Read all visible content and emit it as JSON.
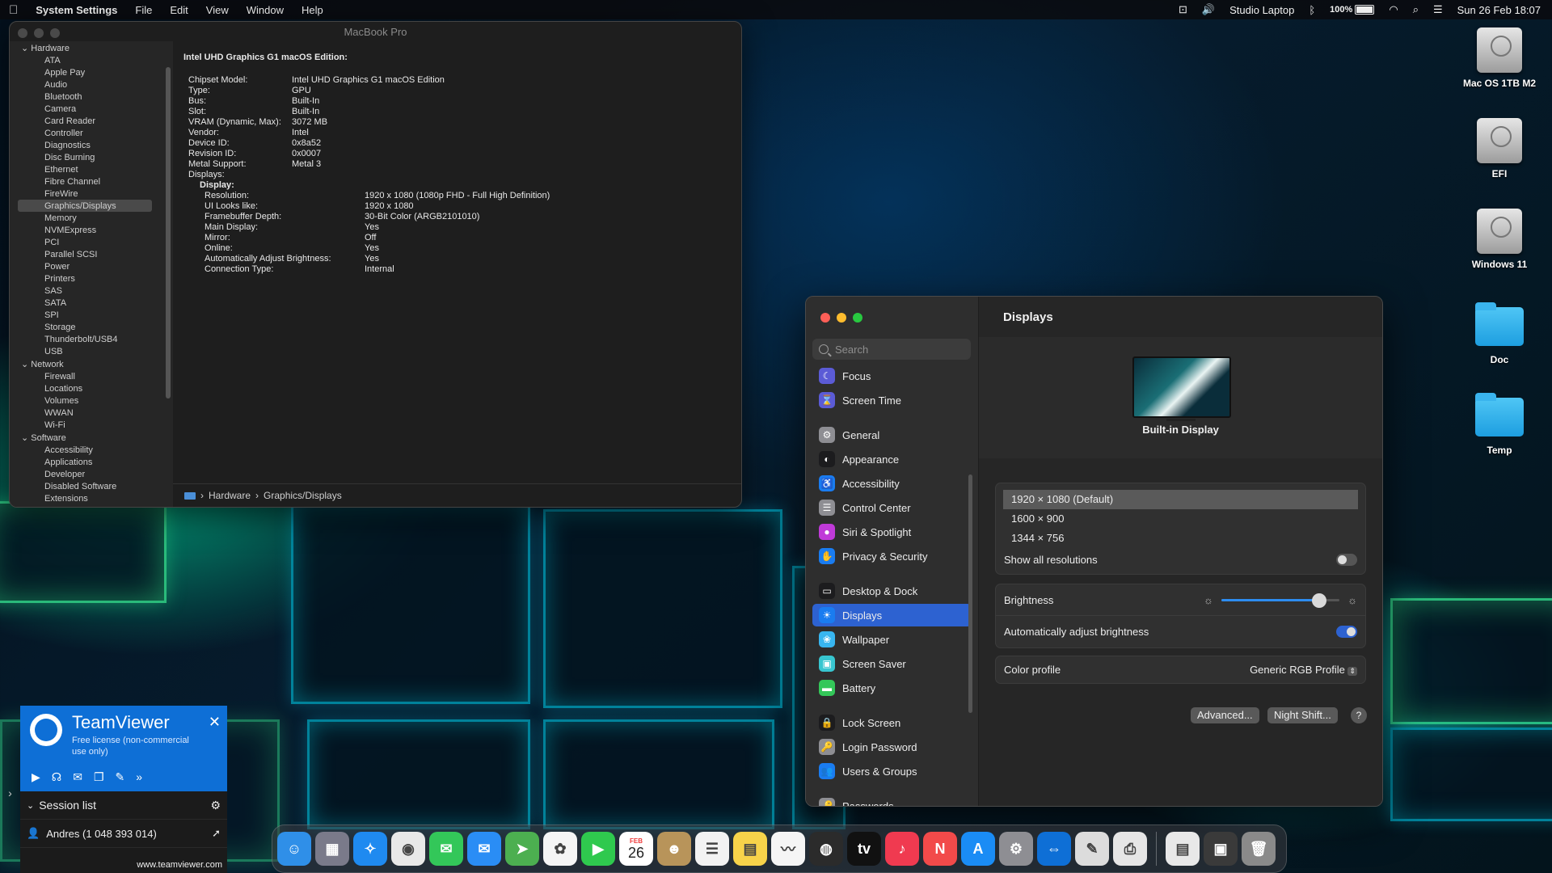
{
  "menubar": {
    "apple": "",
    "app": "System Settings",
    "menus": [
      "File",
      "Edit",
      "View",
      "Window",
      "Help"
    ],
    "right": {
      "user": "Studio Laptop",
      "battery": "100%",
      "datetime": "Sun 26 Feb  18:07"
    }
  },
  "desktop_icons": [
    "Mac OS 1TB M2",
    "EFI",
    "Windows 11",
    "Doc",
    "Temp"
  ],
  "sysinfo": {
    "title": "MacBook Pro",
    "sidebar": [
      {
        "t": "cat",
        "label": "Hardware"
      },
      {
        "t": "it",
        "label": "ATA"
      },
      {
        "t": "it",
        "label": "Apple Pay"
      },
      {
        "t": "it",
        "label": "Audio"
      },
      {
        "t": "it",
        "label": "Bluetooth"
      },
      {
        "t": "it",
        "label": "Camera"
      },
      {
        "t": "it",
        "label": "Card Reader"
      },
      {
        "t": "it",
        "label": "Controller"
      },
      {
        "t": "it",
        "label": "Diagnostics"
      },
      {
        "t": "it",
        "label": "Disc Burning"
      },
      {
        "t": "it",
        "label": "Ethernet"
      },
      {
        "t": "it",
        "label": "Fibre Channel"
      },
      {
        "t": "it",
        "label": "FireWire"
      },
      {
        "t": "sel",
        "label": "Graphics/Displays"
      },
      {
        "t": "it",
        "label": "Memory"
      },
      {
        "t": "it",
        "label": "NVMExpress"
      },
      {
        "t": "it",
        "label": "PCI"
      },
      {
        "t": "it",
        "label": "Parallel SCSI"
      },
      {
        "t": "it",
        "label": "Power"
      },
      {
        "t": "it",
        "label": "Printers"
      },
      {
        "t": "it",
        "label": "SAS"
      },
      {
        "t": "it",
        "label": "SATA"
      },
      {
        "t": "it",
        "label": "SPI"
      },
      {
        "t": "it",
        "label": "Storage"
      },
      {
        "t": "it",
        "label": "Thunderbolt/USB4"
      },
      {
        "t": "it",
        "label": "USB"
      },
      {
        "t": "cat",
        "label": "Network"
      },
      {
        "t": "it",
        "label": "Firewall"
      },
      {
        "t": "it",
        "label": "Locations"
      },
      {
        "t": "it",
        "label": "Volumes"
      },
      {
        "t": "it",
        "label": "WWAN"
      },
      {
        "t": "it",
        "label": "Wi-Fi"
      },
      {
        "t": "cat",
        "label": "Software"
      },
      {
        "t": "it",
        "label": "Accessibility"
      },
      {
        "t": "it",
        "label": "Applications"
      },
      {
        "t": "it",
        "label": "Developer"
      },
      {
        "t": "it",
        "label": "Disabled Software"
      },
      {
        "t": "it",
        "label": "Extensions"
      }
    ],
    "heading": "Intel UHD Graphics G1 macOS Edition:",
    "props": [
      {
        "lvl": 0,
        "k": "Chipset Model:",
        "v": "Intel UHD Graphics G1 macOS Edition"
      },
      {
        "lvl": 0,
        "k": "Type:",
        "v": "GPU"
      },
      {
        "lvl": 0,
        "k": "Bus:",
        "v": "Built-In"
      },
      {
        "lvl": 0,
        "k": "Slot:",
        "v": "Built-In"
      },
      {
        "lvl": 0,
        "k": "VRAM (Dynamic, Max):",
        "v": "3072 MB"
      },
      {
        "lvl": 0,
        "k": "Vendor:",
        "v": "Intel"
      },
      {
        "lvl": 0,
        "k": "Device ID:",
        "v": "0x8a52"
      },
      {
        "lvl": 0,
        "k": "Revision ID:",
        "v": "0x0007"
      },
      {
        "lvl": 0,
        "k": "Metal Support:",
        "v": "Metal 3"
      },
      {
        "lvl": 0,
        "k": "Displays:",
        "v": ""
      },
      {
        "lvl": 1,
        "k": "Display:",
        "v": ""
      },
      {
        "lvl": 2,
        "k": "Resolution:",
        "v": "1920 x 1080 (1080p FHD - Full High Definition)"
      },
      {
        "lvl": 2,
        "k": "UI Looks like:",
        "v": "1920 x 1080"
      },
      {
        "lvl": 2,
        "k": "Framebuffer Depth:",
        "v": "30-Bit Color (ARGB2101010)"
      },
      {
        "lvl": 2,
        "k": "Main Display:",
        "v": "Yes"
      },
      {
        "lvl": 2,
        "k": "Mirror:",
        "v": "Off"
      },
      {
        "lvl": 2,
        "k": "Online:",
        "v": "Yes"
      },
      {
        "lvl": 2,
        "k": "Automatically Adjust Brightness:",
        "v": "Yes"
      },
      {
        "lvl": 2,
        "k": "Connection Type:",
        "v": "Internal"
      }
    ],
    "path": [
      "Hardware",
      "Graphics/Displays"
    ]
  },
  "settings": {
    "search_placeholder": "Search",
    "sidebar": [
      {
        "label": "Focus",
        "color": "#5b5bd6",
        "icon": "moon-icon",
        "glyph": "☾"
      },
      {
        "label": "Screen Time",
        "color": "#5b5bd6",
        "icon": "hourglass-icon",
        "glyph": "⌛"
      },
      {
        "gap": true
      },
      {
        "label": "General",
        "color": "#8e8e93",
        "icon": "gear-icon",
        "glyph": "⚙"
      },
      {
        "label": "Appearance",
        "color": "#1c1c1e",
        "icon": "appearance-icon",
        "glyph": "◐"
      },
      {
        "label": "Accessibility",
        "color": "#1a7cf0",
        "icon": "accessibility-icon",
        "glyph": "♿"
      },
      {
        "label": "Control Center",
        "color": "#8e8e93",
        "icon": "toggles-icon",
        "glyph": "☰"
      },
      {
        "label": "Siri & Spotlight",
        "color": "#c03ad8",
        "icon": "siri-icon",
        "glyph": "●"
      },
      {
        "label": "Privacy & Security",
        "color": "#1a7cf0",
        "icon": "hand-icon",
        "glyph": "✋"
      },
      {
        "gap": true
      },
      {
        "label": "Desktop & Dock",
        "color": "#1c1c1e",
        "icon": "dock-icon",
        "glyph": "▭"
      },
      {
        "label": "Displays",
        "color": "#1a7cf0",
        "icon": "sun-icon",
        "glyph": "☀",
        "selected": true
      },
      {
        "label": "Wallpaper",
        "color": "#38b6f0",
        "icon": "flower-icon",
        "glyph": "❀"
      },
      {
        "label": "Screen Saver",
        "color": "#38c6d0",
        "icon": "screensaver-icon",
        "glyph": "▣"
      },
      {
        "label": "Battery",
        "color": "#34c759",
        "icon": "battery-icon",
        "glyph": "▬"
      },
      {
        "gap": true
      },
      {
        "label": "Lock Screen",
        "color": "#1c1c1e",
        "icon": "lock-icon",
        "glyph": "🔒"
      },
      {
        "label": "Login Password",
        "color": "#8e8e93",
        "icon": "key-icon",
        "glyph": "🔑"
      },
      {
        "label": "Users & Groups",
        "color": "#1a7cf0",
        "icon": "users-icon",
        "glyph": "👥"
      },
      {
        "gap": true
      },
      {
        "label": "Passwords",
        "color": "#8e8e93",
        "icon": "key-icon",
        "glyph": "🔑"
      }
    ],
    "title": "Displays",
    "display_name": "Built-in Display",
    "resolutions": [
      "1920 × 1080 (Default)",
      "1600 × 900",
      "1344 × 756"
    ],
    "show_all_label": "Show all resolutions",
    "show_all_on": false,
    "brightness_label": "Brightness",
    "brightness_level": 0.83,
    "auto_brightness_label": "Automatically adjust brightness",
    "auto_brightness_on": true,
    "color_profile_label": "Color profile",
    "color_profile_value": "Generic RGB Profile",
    "advanced_label": "Advanced...",
    "night_shift_label": "Night Shift...",
    "help_label": "?"
  },
  "teamviewer": {
    "name": "TeamViewer",
    "license": "Free license (non-commercial use only)",
    "session_list": "Session list",
    "contact": "Andres (1 048 393 014)",
    "footer": "www.teamviewer.com"
  },
  "dock": {
    "calendar_month": "FEB",
    "calendar_day": "26",
    "apps": [
      {
        "name": "finder-icon",
        "color": "#2f8fe8",
        "glyph": "☺"
      },
      {
        "name": "launchpad-icon",
        "color": "#7a7a8a",
        "glyph": "▦"
      },
      {
        "name": "safari-icon",
        "color": "#1f8af0",
        "glyph": "✧"
      },
      {
        "name": "chrome-icon",
        "color": "#e8e8e8",
        "glyph": "◉"
      },
      {
        "name": "messages-icon",
        "color": "#33c759",
        "glyph": "✉"
      },
      {
        "name": "mail-icon",
        "color": "#2a8df5",
        "glyph": "✉"
      },
      {
        "name": "maps-icon",
        "color": "#4caf50",
        "glyph": "➤"
      },
      {
        "name": "photos-icon",
        "color": "#f5f5f5",
        "glyph": "✿"
      },
      {
        "name": "facetime-icon",
        "color": "#2fc94e",
        "glyph": "▶"
      },
      {
        "name": "calendar-icon",
        "color": "#ffffff",
        "glyph": ""
      },
      {
        "name": "contacts-icon",
        "color": "#b8945a",
        "glyph": "☻"
      },
      {
        "name": "reminders-icon",
        "color": "#f2f2f2",
        "glyph": "☰"
      },
      {
        "name": "notes-icon",
        "color": "#f7d34a",
        "glyph": "▤"
      },
      {
        "name": "freeform-icon",
        "color": "#f5f5f5",
        "glyph": "〰"
      },
      {
        "name": "mission-control-icon",
        "color": "#2b2b2b",
        "glyph": "◍"
      },
      {
        "name": "apple-tv-icon",
        "color": "#111111",
        "glyph": "tv"
      },
      {
        "name": "music-icon",
        "color": "#f03a50",
        "glyph": "♪"
      },
      {
        "name": "news-icon",
        "color": "#f24a4a",
        "glyph": "N"
      },
      {
        "name": "app-store-icon",
        "color": "#1a8cf5",
        "glyph": "A"
      },
      {
        "name": "system-settings-icon",
        "color": "#8e8e93",
        "glyph": "⚙"
      },
      {
        "name": "teamviewer-icon",
        "color": "#0e6fd6",
        "glyph": "⇔"
      },
      {
        "name": "script-editor-icon",
        "color": "#dcdcdc",
        "glyph": "✎"
      },
      {
        "name": "printer-icon",
        "color": "#e6e6e6",
        "glyph": "⎙"
      }
    ],
    "right": [
      {
        "name": "document-icon",
        "color": "#e8e8e8",
        "glyph": "▤"
      },
      {
        "name": "screenshot-thumbnail-icon",
        "color": "#3a3a3a",
        "glyph": "▣"
      },
      {
        "name": "trash-icon",
        "color": "#8a8a8a",
        "glyph": "🗑"
      }
    ]
  }
}
